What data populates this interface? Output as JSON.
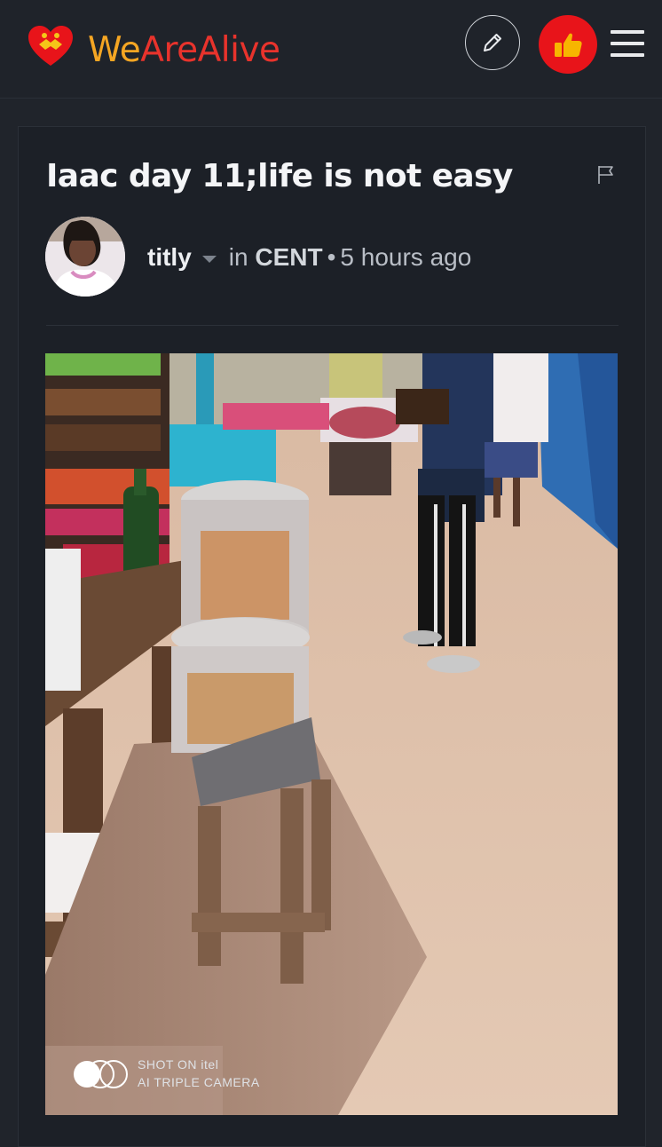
{
  "header": {
    "logo_we": "We",
    "logo_arealive": "AreAlive",
    "edit_icon": "pencil-icon",
    "like_icon": "thumbs-up-icon",
    "menu_icon": "hamburger-menu-icon"
  },
  "post": {
    "title": "Iaac day 11;life is not easy",
    "author": "titly",
    "in_label": "in",
    "community": "CENT",
    "time": "5 hours ago",
    "flag_icon": "flag-icon"
  },
  "photo": {
    "watermark_line1": "SHOT ON itel",
    "watermark_line2": "AI TRIPLE CAMERA"
  },
  "colors": {
    "background": "#20242b",
    "accent_red": "#e8141a",
    "logo_orange": "#f5a623",
    "logo_red": "#e8332c"
  }
}
